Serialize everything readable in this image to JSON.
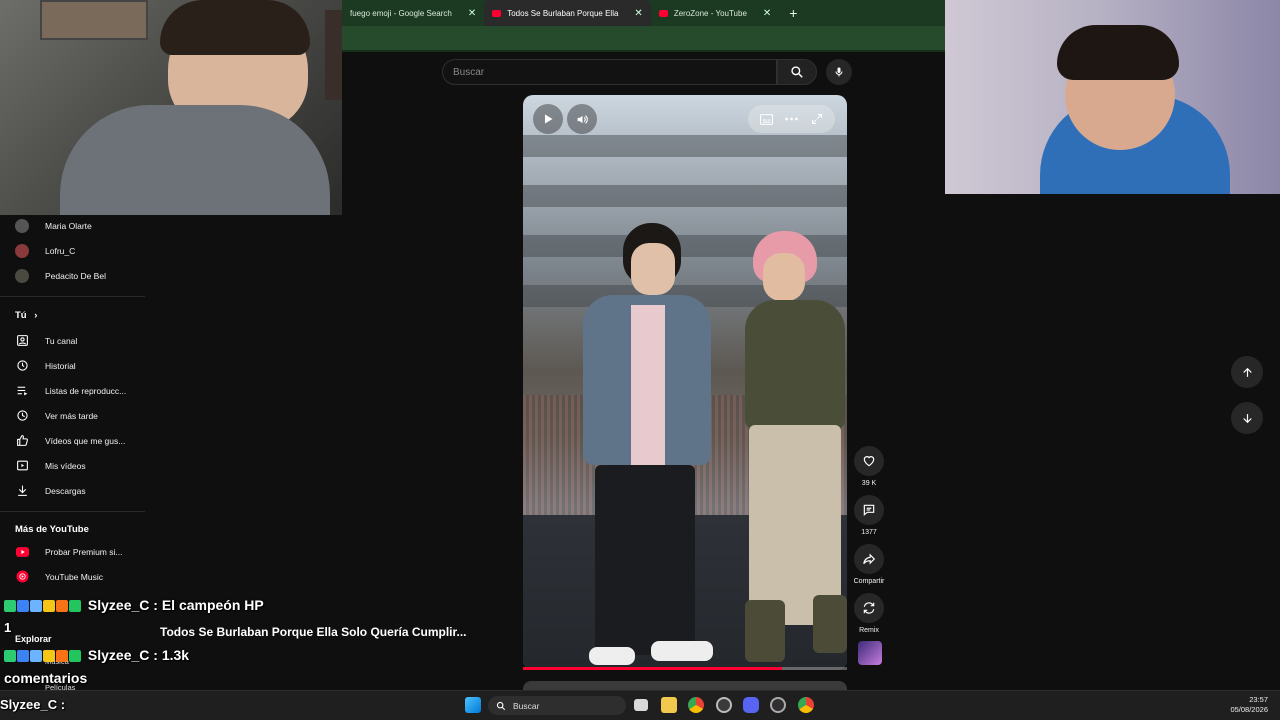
{
  "browser": {
    "tabs": [
      {
        "label": "fuego emoji - Google Search",
        "active": false
      },
      {
        "label": "Todos Se Burlaban Porque Ella",
        "active": true
      },
      {
        "label": "ZeroZone - YouTube",
        "active": false
      }
    ]
  },
  "search": {
    "placeholder": "Buscar"
  },
  "sidebar": {
    "subscriptions": [
      {
        "label": "Maria Olarte"
      },
      {
        "label": "Lofru_C"
      },
      {
        "label": "Pedacito De Bel"
      }
    ],
    "you_heading": "Tú",
    "you_items": [
      {
        "label": "Tu canal",
        "icon": "channel-icon"
      },
      {
        "label": "Historial",
        "icon": "history-icon"
      },
      {
        "label": "Listas de reproducc...",
        "icon": "playlists-icon"
      },
      {
        "label": "Ver más tarde",
        "icon": "watch-later-icon"
      },
      {
        "label": "Vídeos que me gus...",
        "icon": "thumbs-up-icon"
      },
      {
        "label": "Mis vídeos",
        "icon": "my-videos-icon"
      },
      {
        "label": "Descargas",
        "icon": "download-icon"
      }
    ],
    "more_heading": "Más de YouTube",
    "more_items": [
      {
        "label": "Probar Premium si...",
        "icon": "youtube-premium-icon"
      },
      {
        "label": "YouTube Music",
        "icon": "youtube-music-icon"
      }
    ],
    "explore_heading": "Explorar",
    "explore_items": [
      {
        "label": "Música"
      },
      {
        "label": "Películas"
      }
    ]
  },
  "short": {
    "title": "Todos Se Burlaban Porque Ella Solo Quería Cumplir...",
    "progress_fraction": 0.8,
    "actions": {
      "like_count": "39 K",
      "comment_count": "1377",
      "share_label": "Compartir",
      "remix_label": "Remix"
    }
  },
  "overlay": {
    "chat_line_1_user": "Slyzee_C :",
    "chat_line_1_text": "El campeón HP",
    "chat_line_2_user": "Slyzee_C :",
    "chat_line_2_text": "1.3k",
    "side_number": "1",
    "comments_label": "comentarios",
    "bottom_user": "Slyzee_C :"
  },
  "taskbar": {
    "search_label": "Buscar",
    "time": "23:57",
    "date": "05/08/2026"
  },
  "colors": {
    "youtube_red": "#ff0033",
    "browser_frame": "#1c3a22"
  }
}
